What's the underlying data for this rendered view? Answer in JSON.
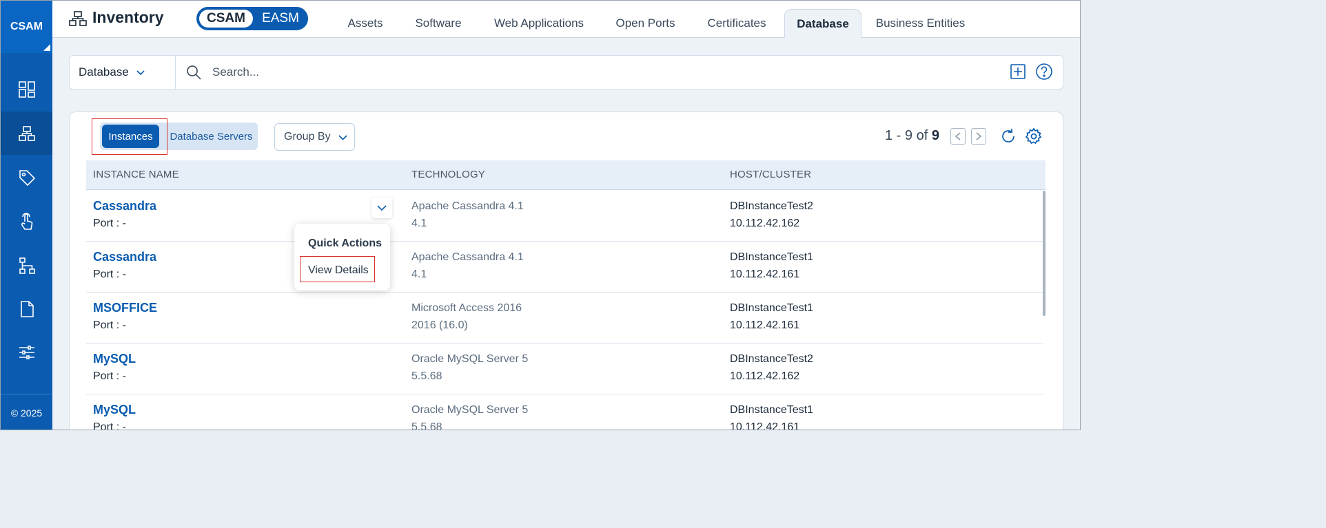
{
  "sidebar": {
    "brand": "CSAM",
    "items": [
      {
        "name": "dashboard",
        "icon": "dashboard-icon"
      },
      {
        "name": "inventory",
        "icon": "inventory-icon",
        "active": true
      },
      {
        "name": "tags",
        "icon": "tag-icon"
      },
      {
        "name": "responses",
        "icon": "touch-icon"
      },
      {
        "name": "hierarchy",
        "icon": "hierarchy-icon"
      },
      {
        "name": "reports",
        "icon": "document-icon"
      },
      {
        "name": "configuration",
        "icon": "sliders-icon"
      }
    ],
    "copyright": "© 2025"
  },
  "header": {
    "title": "Inventory",
    "toggle": {
      "selected": "CSAM",
      "other": "EASM"
    },
    "tabs": [
      {
        "label": "Assets"
      },
      {
        "label": "Software"
      },
      {
        "label": "Web Applications"
      },
      {
        "label": "Open Ports"
      },
      {
        "label": "Certificates"
      },
      {
        "label": "Database",
        "active": true
      },
      {
        "label": "Business Entities"
      }
    ]
  },
  "search": {
    "scope": "Database",
    "placeholder": "Search..."
  },
  "panel": {
    "view_active": "Instances",
    "view_inactive": "Database Servers",
    "group_by": "Group By",
    "pager": {
      "range": "1 - 9",
      "of": "of",
      "total": "9"
    }
  },
  "table": {
    "columns": [
      "INSTANCE NAME",
      "TECHNOLOGY",
      "HOST/CLUSTER"
    ],
    "rows": [
      {
        "name": "Cassandra",
        "port": "Port : -",
        "tech": "Apache Cassandra 4.1",
        "version": "4.1",
        "host": "DBInstanceTest2",
        "ip": "10.112.42.162"
      },
      {
        "name": "Cassandra",
        "port": "Port : -",
        "tech": "Apache Cassandra 4.1",
        "version": "4.1",
        "host": "DBInstanceTest1",
        "ip": "10.112.42.161"
      },
      {
        "name": "MSOFFICE",
        "port": "Port : -",
        "tech": "Microsoft Access 2016",
        "version": "2016 (16.0)",
        "host": "DBInstanceTest1",
        "ip": "10.112.42.161"
      },
      {
        "name": "MySQL",
        "port": "Port : -",
        "tech": "Oracle MySQL Server 5",
        "version": "5.5.68",
        "host": "DBInstanceTest2",
        "ip": "10.112.42.162"
      },
      {
        "name": "MySQL",
        "port": "Port : -",
        "tech": "Oracle MySQL Server 5",
        "version": "5.5.68",
        "host": "DBInstanceTest1",
        "ip": "10.112.42.161"
      }
    ]
  },
  "quick_actions": {
    "title": "Quick Actions",
    "item": "View Details"
  },
  "colors": {
    "brand": "#0b5cb0",
    "highlight": "#d9302b"
  }
}
